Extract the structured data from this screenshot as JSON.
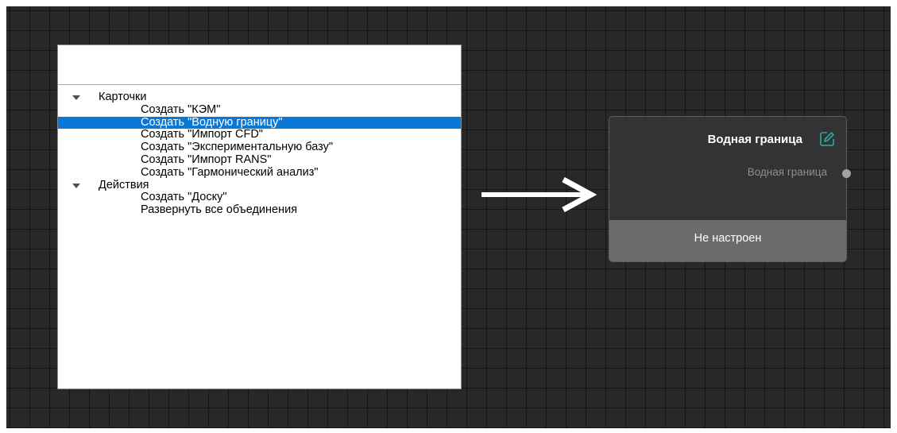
{
  "menu": {
    "search": {
      "value": "",
      "placeholder": ""
    },
    "categories": [
      {
        "label": "Карточки",
        "items": [
          {
            "label": "Создать \"КЭМ\""
          },
          {
            "label": "Создать \"Водную границу\"",
            "selected": true
          },
          {
            "label": "Создать \"Импорт CFD\""
          },
          {
            "label": "Создать \"Экспериментальную базу\""
          },
          {
            "label": "Создать \"Импорт RANS\""
          },
          {
            "label": "Создать \"Гармонический анализ\""
          }
        ]
      },
      {
        "label": "Действия",
        "items": [
          {
            "label": "Создать \"Доску\""
          },
          {
            "label": "Развернуть все объединения"
          }
        ]
      }
    ]
  },
  "node": {
    "title": "Водная граница",
    "port_label": "Водная граница",
    "status": "Не настроен",
    "edit_icon": "pencil-square-icon"
  },
  "colors": {
    "canvas_bg": "#282828",
    "grid_line": "#151515",
    "selection": "#0a78d7",
    "edit_icon": "#27b0a0",
    "node_body": "#333333",
    "node_status_bg": "#6b6b6b"
  }
}
